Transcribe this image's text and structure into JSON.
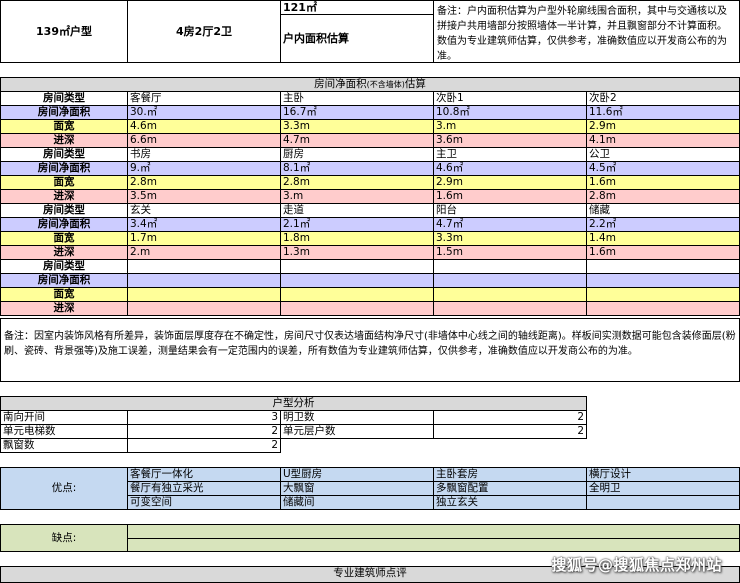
{
  "top": {
    "area_label": "139㎡户型",
    "layout": "4房2厅2卫",
    "area_value": "121㎡",
    "area_estimate_label": "户内面积估算",
    "note": "备注：户内面积估算为户型外轮廓线围合面积，其中与交通核以及拼接户共用墙部分按照墙体一半计算，并且飘窗部分不计算面积。数值为专业建筑师估算，仅供参考，准确数值应以开发商公布的为准。"
  },
  "net_area": {
    "title_main": "房间净面积",
    "title_sub": "(不含墙体)",
    "title_tail": "估算",
    "row_labels": [
      "房间类型",
      "房间净面积",
      "面宽",
      "进深"
    ],
    "groups": [
      {
        "rooms": [
          {
            "name": "客餐厅",
            "area": "30.㎡",
            "width": "4.6m",
            "depth": "6.6m"
          },
          {
            "name": "主卧",
            "area": "16.7㎡",
            "width": "3.3m",
            "depth": "4.7m"
          },
          {
            "name": "次卧1",
            "area": "10.8㎡",
            "width": "3.m",
            "depth": "3.6m"
          },
          {
            "name": "次卧2",
            "area": "11.6㎡",
            "width": "2.9m",
            "depth": "4.1m"
          }
        ]
      },
      {
        "rooms": [
          {
            "name": "书房",
            "area": "9.㎡",
            "width": "2.8m",
            "depth": "3.5m"
          },
          {
            "name": "厨房",
            "area": "8.1㎡",
            "width": "2.8m",
            "depth": "3.m"
          },
          {
            "name": "主卫",
            "area": "4.6㎡",
            "width": "2.9m",
            "depth": "1.6m"
          },
          {
            "name": "公卫",
            "area": "4.5㎡",
            "width": "1.6m",
            "depth": "2.8m"
          }
        ]
      },
      {
        "rooms": [
          {
            "name": "玄关",
            "area": "3.4㎡",
            "width": "1.7m",
            "depth": "2.m"
          },
          {
            "name": "走道",
            "area": "2.1㎡",
            "width": "1.8m",
            "depth": "1.3m"
          },
          {
            "name": "阳台",
            "area": "4.7㎡",
            "width": "3.3m",
            "depth": "1.5m"
          },
          {
            "name": "储藏",
            "area": "2.2㎡",
            "width": "1.4m",
            "depth": "1.6m"
          }
        ]
      },
      {
        "rooms": [
          {
            "name": "",
            "area": "",
            "width": "",
            "depth": ""
          },
          {
            "name": "",
            "area": "",
            "width": "",
            "depth": ""
          },
          {
            "name": "",
            "area": "",
            "width": "",
            "depth": ""
          },
          {
            "name": "",
            "area": "",
            "width": "",
            "depth": ""
          }
        ]
      }
    ],
    "note": "备注：因室内装饰风格有所差异，装饰面层厚度存在不确定性，房间尺寸仅表达墙面结构净尺寸(非墙体中心线之间的轴线距离)。样板间实测数据可能包含装修面层(粉刷、瓷砖、背景强等)及施工误差，测量结果会有一定范围内的误差，所有数值为专业建筑师估算，仅供参考，准确数值应以开发商公布的为准。"
  },
  "analysis": {
    "title": "户型分析",
    "rows": [
      {
        "label": "南向开间",
        "value": "3",
        "label2": "明卫数",
        "value2": "2"
      },
      {
        "label": "单元电梯数",
        "value": "2",
        "label2": "单元层户数",
        "value2": "2"
      },
      {
        "label": "飘窗数",
        "value": "2",
        "label2": "",
        "value2": ""
      }
    ]
  },
  "pros": {
    "label": "优点:",
    "rows": [
      [
        "客餐厅一体化",
        "U型厨房",
        "主卧套房",
        "横厅设计"
      ],
      [
        "餐厅有独立采光",
        "大飘窗",
        "多飘窗配置",
        "全明卫"
      ],
      [
        "可变空间",
        "储藏间",
        "独立玄关",
        ""
      ]
    ]
  },
  "cons": {
    "label": "缺点:"
  },
  "review": {
    "title": "专业建筑师点评"
  },
  "watermark": "搜狐号@搜狐焦点郑州站"
}
